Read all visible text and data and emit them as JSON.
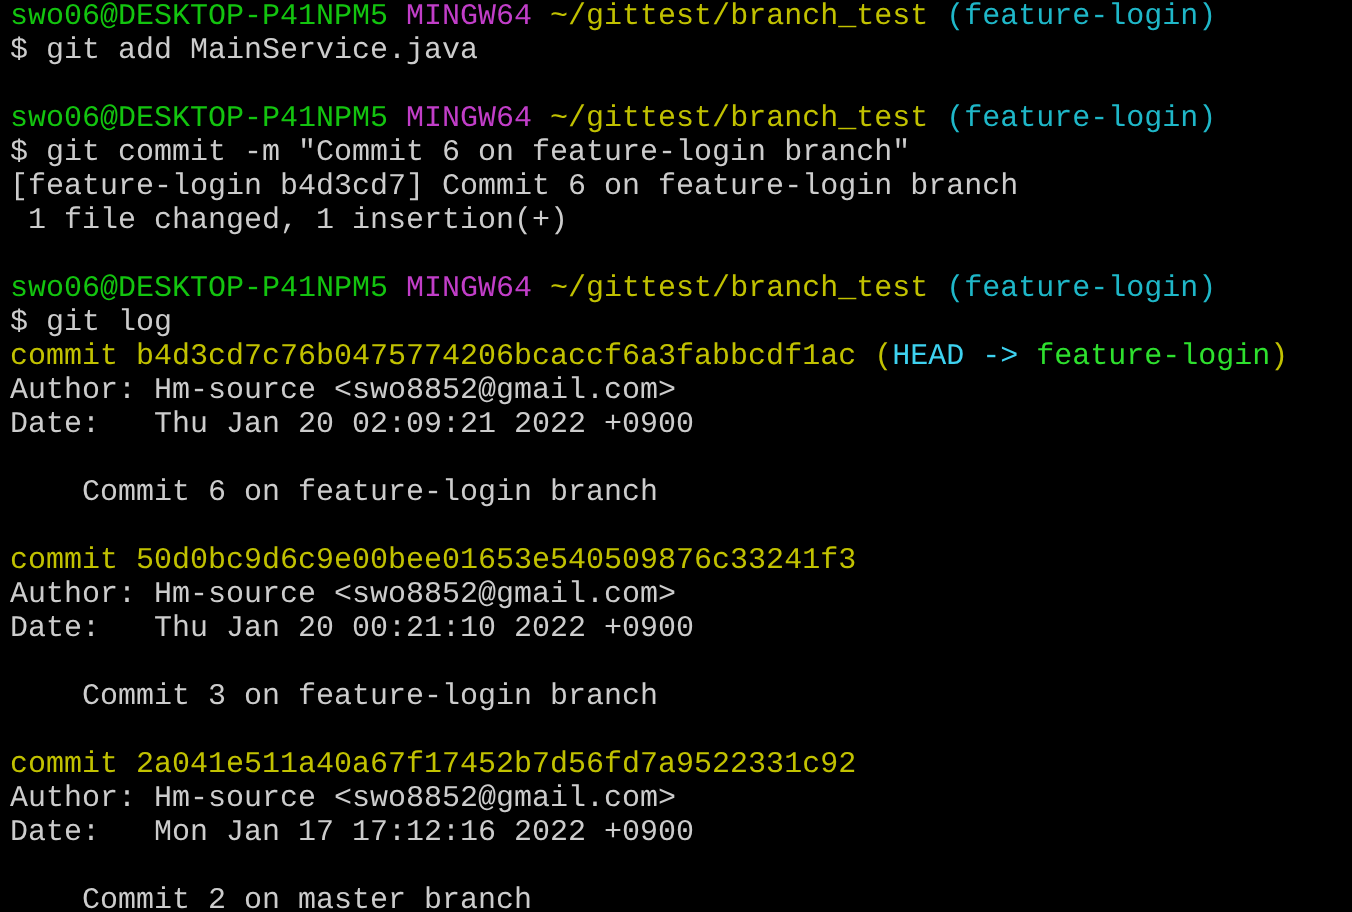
{
  "terminal": {
    "lines": [
      {
        "kind": "text",
        "segments": [
          {
            "kind": "user",
            "text": "swo06@DESKTOP-P41NPM5"
          },
          {
            "kind": "system",
            "text": " MINGW64"
          },
          {
            "kind": "path",
            "text": " ~/gittest/branch_test"
          },
          {
            "kind": "branch",
            "text": " (feature-login)"
          }
        ]
      },
      {
        "kind": "text",
        "segments": [
          {
            "kind": "plain",
            "text": "$ git add MainService.java"
          }
        ]
      },
      {
        "kind": "blank"
      },
      {
        "kind": "text",
        "segments": [
          {
            "kind": "user",
            "text": "swo06@DESKTOP-P41NPM5"
          },
          {
            "kind": "system",
            "text": " MINGW64"
          },
          {
            "kind": "path",
            "text": " ~/gittest/branch_test"
          },
          {
            "kind": "branch",
            "text": " (feature-login)"
          }
        ]
      },
      {
        "kind": "text",
        "segments": [
          {
            "kind": "plain",
            "text": "$ git commit -m \"Commit 6 on feature-login branch\""
          }
        ]
      },
      {
        "kind": "text",
        "segments": [
          {
            "kind": "plain",
            "text": "[feature-login b4d3cd7] Commit 6 on feature-login branch"
          }
        ]
      },
      {
        "kind": "text",
        "segments": [
          {
            "kind": "plain",
            "text": " 1 file changed, 1 insertion(+)"
          }
        ]
      },
      {
        "kind": "blank"
      },
      {
        "kind": "text",
        "segments": [
          {
            "kind": "user",
            "text": "swo06@DESKTOP-P41NPM5"
          },
          {
            "kind": "system",
            "text": " MINGW64"
          },
          {
            "kind": "path",
            "text": " ~/gittest/branch_test"
          },
          {
            "kind": "branch",
            "text": " (feature-login)"
          }
        ]
      },
      {
        "kind": "text",
        "segments": [
          {
            "kind": "plain",
            "text": "$ git log"
          }
        ]
      },
      {
        "kind": "text",
        "segments": [
          {
            "kind": "commit",
            "text": "commit b4d3cd7c76b0475774206bcaccf6a3fabbcdf1ac ("
          },
          {
            "kind": "head",
            "text": "HEAD ->"
          },
          {
            "kind": "ref",
            "text": " feature-login"
          },
          {
            "kind": "commit",
            "text": ")"
          }
        ]
      },
      {
        "kind": "text",
        "segments": [
          {
            "kind": "plain",
            "text": "Author: Hm-source <swo8852@gmail.com>"
          }
        ]
      },
      {
        "kind": "text",
        "segments": [
          {
            "kind": "plain",
            "text": "Date:   Thu Jan 20 02:09:21 2022 +0900"
          }
        ]
      },
      {
        "kind": "blank"
      },
      {
        "kind": "text",
        "segments": [
          {
            "kind": "plain",
            "text": "    Commit 6 on feature-login branch"
          }
        ]
      },
      {
        "kind": "blank"
      },
      {
        "kind": "text",
        "segments": [
          {
            "kind": "commit",
            "text": "commit 50d0bc9d6c9e00bee01653e540509876c33241f3"
          }
        ]
      },
      {
        "kind": "text",
        "segments": [
          {
            "kind": "plain",
            "text": "Author: Hm-source <swo8852@gmail.com>"
          }
        ]
      },
      {
        "kind": "text",
        "segments": [
          {
            "kind": "plain",
            "text": "Date:   Thu Jan 20 00:21:10 2022 +0900"
          }
        ]
      },
      {
        "kind": "blank"
      },
      {
        "kind": "text",
        "segments": [
          {
            "kind": "plain",
            "text": "    Commit 3 on feature-login branch"
          }
        ]
      },
      {
        "kind": "blank"
      },
      {
        "kind": "text",
        "segments": [
          {
            "kind": "commit",
            "text": "commit 2a041e511a40a67f17452b7d56fd7a9522331c92"
          }
        ]
      },
      {
        "kind": "text",
        "segments": [
          {
            "kind": "plain",
            "text": "Author: Hm-source <swo8852@gmail.com>"
          }
        ]
      },
      {
        "kind": "text",
        "segments": [
          {
            "kind": "plain",
            "text": "Date:   Mon Jan 17 17:12:16 2022 +0900"
          }
        ]
      },
      {
        "kind": "blank"
      },
      {
        "kind": "text",
        "segments": [
          {
            "kind": "plain",
            "text": "    Commit 2 on master branch"
          }
        ]
      }
    ]
  }
}
